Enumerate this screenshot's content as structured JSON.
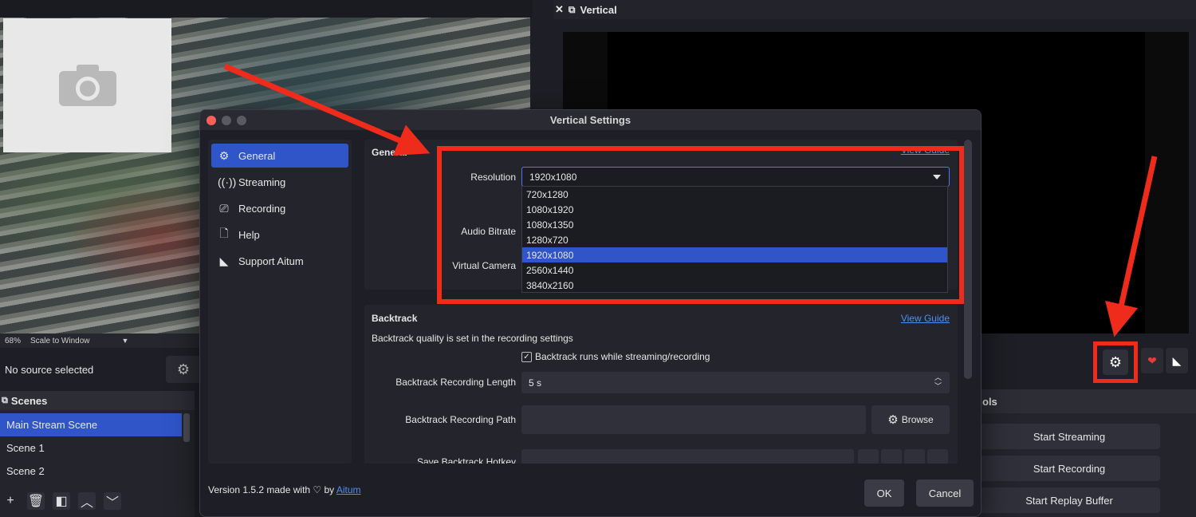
{
  "left_panel": {
    "zoom": "68%",
    "scale_mode": "Scale to Window",
    "source_status": "No source selected",
    "scenes": {
      "title": "Scenes",
      "items": [
        "Main Stream Scene",
        "Scene 1",
        "Scene 2"
      ],
      "selected_index": 0
    }
  },
  "vertical_dock": {
    "title": "Vertical",
    "controls": {
      "title_fragment": "ols",
      "buttons": [
        "Start Streaming",
        "Start Recording",
        "Start Replay Buffer"
      ]
    }
  },
  "dialog": {
    "title": "Vertical Settings",
    "sidebar": [
      "General",
      "Streaming",
      "Recording",
      "Help",
      "Support Aitum"
    ],
    "selected_sidebar_index": 0,
    "general": {
      "title": "General",
      "guide_link_fragment": "View Guide",
      "resolution_label": "Resolution",
      "resolution_value": "1920x1080",
      "resolution_options": [
        "720x1280",
        "1080x1920",
        "1080x1350",
        "1280x720",
        "1920x1080",
        "2560x1440",
        "3840x2160"
      ],
      "selected_option_index": 4,
      "audio_bitrate_label": "Audio Bitrate",
      "virtual_camera_label": "Virtual Camera"
    },
    "backtrack": {
      "title": "Backtrack",
      "view_guide": "View Guide",
      "note": "Backtrack quality is set in the recording settings",
      "checkbox_label": "Backtrack runs while streaming/recording",
      "checkbox_checked": true,
      "length_label": "Backtrack Recording Length",
      "length_value": "5 s",
      "path_label": "Backtrack Recording Path",
      "path_value": "",
      "browse_label": "Browse",
      "hotkey_label": "Save Backtrack Hotkey"
    },
    "footer": {
      "version_prefix": "Version 1.5.2 made with ♡ by",
      "version_link": "Aitum",
      "ok": "OK",
      "cancel": "Cancel"
    }
  },
  "colors": {
    "accent": "#2f55c9",
    "annotation_red": "#ef2b1c",
    "link": "#4e8ff5"
  }
}
